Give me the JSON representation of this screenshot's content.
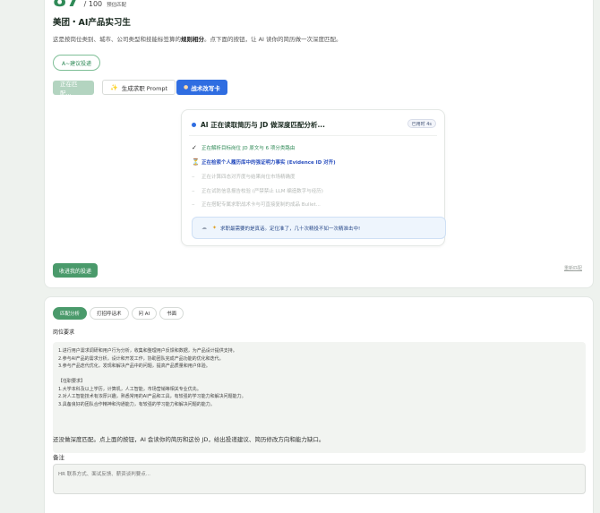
{
  "score": {
    "value": "87",
    "total": "/ 100",
    "label": "预估匹配"
  },
  "role": {
    "title": "美团・AI产品实习生"
  },
  "desc": {
    "before": "这是按岗位类别、城市、公司类型和技能标签算的",
    "bold": "规则相分",
    "after": "。点下面的按钮，让 AI 读你的简历做一次深度匹配。"
  },
  "buttons": {
    "suggest": "A~建议投递",
    "matching": "正在匹配...",
    "prompt": "生成求职 Prompt",
    "rewrite": "战术改写卡",
    "mark_applied": "收进我的投递",
    "reset": "重新匹配"
  },
  "analysis": {
    "title": "AI 正在读取简历与 JD 做深度匹配分析...",
    "elapsed": "已用时 4s",
    "steps": [
      {
        "mark": "✓",
        "text": "正在解析目标岗位 JD 原文与 6 项分类路由"
      },
      {
        "mark": "⏳",
        "text": "正在检索个人履历库中的强证明力事实 (Evidence ID 对齐)"
      },
      {
        "mark": "–",
        "text": "正在计算四态对齐度与结果岗位市场精确度"
      },
      {
        "mark": "–",
        "text": "正在试防信息报告校验 (严禁禁止 LLM 编造数字与经历)"
      },
      {
        "mark": "–",
        "text": "正在搭配专属求职战术卡与可直接复制的成品 Bullet..."
      }
    ],
    "tip": "求职最需要的是真话。定位准了，几十次精投不如一次精准击中!"
  },
  "tabs": [
    "匹配分析",
    "打招呼话术",
    "问 AI",
    "书面"
  ],
  "jd": {
    "label": "岗位要求",
    "lines": [
      "1.进行用户需求调研和用户行为分析，收集和整理用户反馈和数据，为产品设计提供支持。",
      "2.参与AI产品的需求分析，设计和开发工作，协助团队完成产品功能的优化和迭代。",
      "3.参与产品迭代优化，发现和解决产品中的问题，提高产品质量和用户体验。",
      "",
      "【任职要求】",
      "1.大学本科及以上学历，计算机，人工智能，市场营销等相关专业优先。",
      "2.对人工智能技术有浓厚兴趣，熟悉常用的AI产品和工具，有较强的学习能力和解决问题能力。",
      "3.具备良好的团队合作精神和沟通能力，有较强的学习能力和解决问题的能力。"
    ]
  },
  "summary": "还没做深度匹配。点上面的按钮，AI 会读你的简历和这份 JD，给出投递建议、简历修改方向和能力缺口。",
  "note": {
    "label": "备注",
    "placeholder": "HR 联系方式、面试反馈、薪资谈判要点..."
  }
}
